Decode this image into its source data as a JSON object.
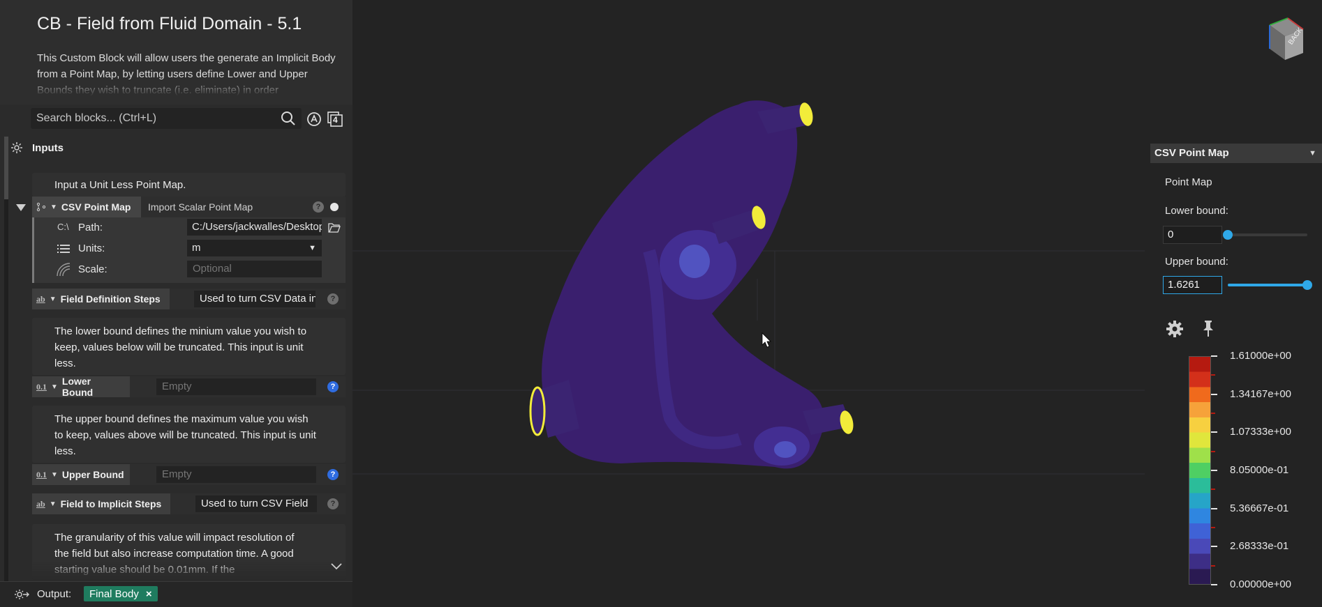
{
  "info": {
    "title": "CB - Field from Fluid Domain - 5.1",
    "description": "This Custom Block will allow users the generate an Implicit Body from a Point Map, by letting users define Lower and Upper Bounds they wish to truncate (i.e. eliminate) in order"
  },
  "search": {
    "placeholder": "Search blocks... (Ctrl+L)"
  },
  "toolbar": {
    "count_badge": "4"
  },
  "inputs": {
    "header": "Inputs",
    "csv_note": "Input a Unit Less Point Map.",
    "csv_block": {
      "tag": "CSV Point Map",
      "name": "Import Scalar Point Map",
      "path_label": "Path:",
      "path_value": "C:/Users/jackwalles/Desktop/",
      "units_label": "Units:",
      "units_value": "m",
      "scale_label": "Scale:",
      "scale_placeholder": "Optional",
      "path_prefix_icon_text": "C:\\"
    },
    "field_def": {
      "tag": "Field Definition Steps",
      "value": "Used to turn CSV Data into"
    },
    "lower_note": "The lower bound defines the minium value you wish to keep, values below will be truncated. This input is unit less.",
    "lower": {
      "tag": "Lower Bound",
      "placeholder": "Empty",
      "tag_prefix": "0.1"
    },
    "upper_note": "The upper bound defines the maximum value you wish to keep, values above will be truncated. This input is unit less.",
    "upper": {
      "tag": "Upper Bound",
      "placeholder": "Empty",
      "tag_prefix": "0.1"
    },
    "implicit_steps": {
      "tag": "Field to Implicit Steps",
      "value": "Used to turn CSV Field"
    },
    "granularity_note": "The granularity of this value will impact resolution of the field but also increase computation time. A good starting value should be 0.01mm. If the",
    "ab_prefix": "ab"
  },
  "output": {
    "label": "Output:",
    "chip": "Final Body",
    "chip_close": "×"
  },
  "right_panel": {
    "header": "CSV Point Map",
    "point_map_label": "Point Map",
    "lower_label": "Lower bound:",
    "lower_value": "0",
    "lower_slider_fraction": 0.0,
    "upper_label": "Upper bound:",
    "upper_value": "1.6261",
    "upper_slider_fraction": 1.0
  },
  "legend": {
    "labels": [
      "1.61000e+00",
      "1.34167e+00",
      "1.07333e+00",
      "8.05000e-01",
      "5.36667e-01",
      "2.68333e-01",
      "0.00000e+00"
    ],
    "colors": [
      "#b51a10",
      "#d3301a",
      "#f06a1c",
      "#f6a23a",
      "#f7d040",
      "#e0e63c",
      "#9fe04a",
      "#4fcf63",
      "#2bbd9a",
      "#26a5c8",
      "#2f86e0",
      "#3f62d6",
      "#4a49b8",
      "#3d2e86",
      "#2a1a52"
    ]
  },
  "view_cube": {
    "face_label": "BACK"
  },
  "colors": {
    "accent": "#2fa8e8",
    "chip": "#1f7c5f",
    "help_blue": "#2f6ce0",
    "mesh": "#3a1f6e",
    "mesh_highlight": "#f2ec3a"
  }
}
